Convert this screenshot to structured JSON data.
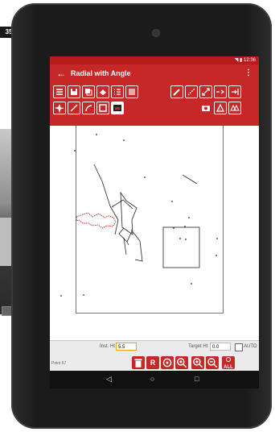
{
  "background": {
    "corner_label": "35"
  },
  "status_bar": {
    "time": "12:36",
    "signal": "◥ ▮"
  },
  "app_bar": {
    "back_icon": "←",
    "title": "Radial with Angle",
    "more_icon": "⋮"
  },
  "toolbar": {
    "icons": [
      "menu-icon",
      "save-icon",
      "layers-icon",
      "fill-icon",
      "list-icon",
      "grid-icon",
      "pencil-icon",
      "measure-icon",
      "dimension-icon",
      "arrow-right-icon",
      "arrow-end-icon",
      "star-icon",
      "line-icon",
      "arc-icon",
      "rectangle-icon",
      "image-icon",
      "camera-icon",
      "triangle-icon",
      "triangles-icon"
    ]
  },
  "bottom_panel": {
    "inst_ht_label": "Inst. Ht",
    "inst_ht_value": "5.5",
    "target_ht_label": "Target Ht",
    "target_ht_value": "0.0",
    "auto_label": "AUTO",
    "point_label": "Point 67",
    "buttons": {
      "delete_icon": "trash-icon",
      "r_label": "R",
      "target_icon": "target-icon",
      "zoom_in_icon": "zoom-in-icon",
      "zoom_in2_icon": "zoom-in-icon",
      "zoom_out_icon": "zoom-out-icon",
      "all_label": "ALL"
    }
  },
  "nav_bar": {
    "back": "◁",
    "home": "○",
    "recents": "□"
  },
  "colors": {
    "accent": "#c62828",
    "accent_dark": "#b71c1c"
  }
}
